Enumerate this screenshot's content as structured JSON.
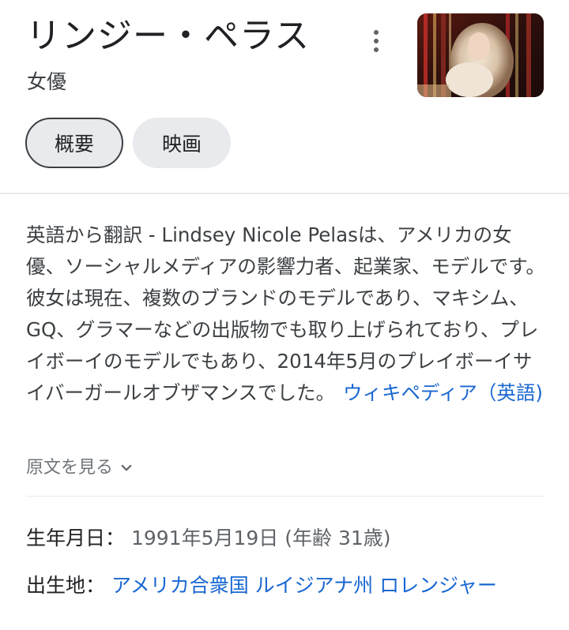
{
  "header": {
    "title": "リンジー・ペラス",
    "subtitle": "女優",
    "more_icon": "more-vert-icon",
    "thumbnail_alt": "リンジー・ペラス"
  },
  "tabs": [
    {
      "label": "概要",
      "selected": true
    },
    {
      "label": "映画",
      "selected": false
    }
  ],
  "description": {
    "text": "英語から翻訳 - Lindsey Nicole Pelasは、アメリカの女優、ソーシャルメディアの影響力者、起業家、モデルです。彼女は現在、複数のブランドのモデルであり、マキシム、GQ、グラマーなどの出版物でも取り上げられており、プレイボーイのモデルでもあり、2014年5月のプレイボーイサイバーガールオブザマンスでした。",
    "source_link": "ウィキペディア（英語)"
  },
  "view_original": {
    "label": "原文を見る",
    "icon": "chevron-down-icon"
  },
  "facts": {
    "born": {
      "label": "生年月日：",
      "value": "1991年5月19日 (年齢 31歳)"
    },
    "birthplace": {
      "label": "出生地：",
      "value": "アメリカ合衆国 ルイジアナ州 ロレンジャー"
    }
  },
  "colors": {
    "link": "#1967d2",
    "text": "#202124",
    "secondary": "#5f6368",
    "chip_bg": "#e8eaed"
  }
}
